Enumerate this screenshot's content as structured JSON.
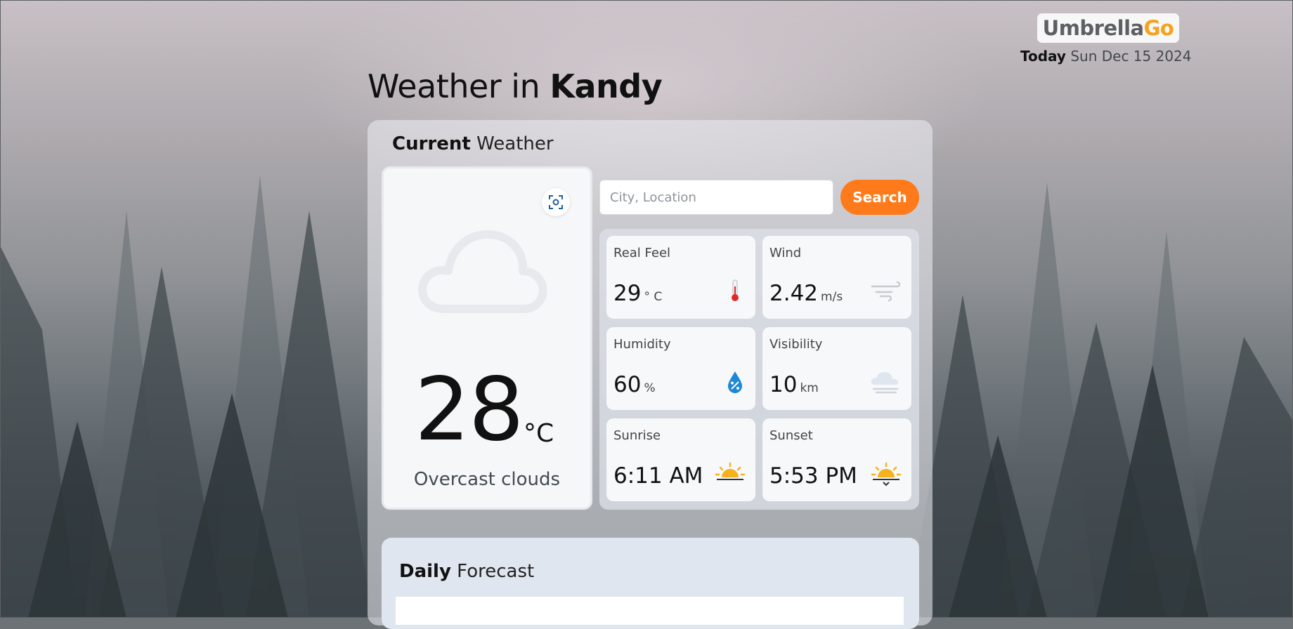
{
  "brand": {
    "part1": "Umbrella",
    "part2": "Go"
  },
  "today": {
    "label": "Today",
    "date": "Sun Dec 15 2024"
  },
  "title": {
    "prefix": "Weather in ",
    "city": "Kandy"
  },
  "current_heading": {
    "bold": "Current",
    "rest": " Weather"
  },
  "current": {
    "temperature": "28",
    "unit": "°C",
    "description": "Overcast clouds",
    "icon": "cloud-icon"
  },
  "search": {
    "placeholder": "City, Location",
    "button": "Search"
  },
  "stats": [
    {
      "label": "Real Feel",
      "value": "29",
      "unit": "° C",
      "icon": "thermometer-icon"
    },
    {
      "label": "Wind",
      "value": "2.42",
      "unit": "m/s",
      "icon": "wind-icon"
    },
    {
      "label": "Humidity",
      "value": "60",
      "unit": "%",
      "icon": "humidity-drop-icon"
    },
    {
      "label": "Visibility",
      "value": "10",
      "unit": "km",
      "icon": "fog-cloud-icon"
    },
    {
      "label": "Sunrise",
      "value": "6:11 AM",
      "unit": "",
      "icon": "sunrise-icon"
    },
    {
      "label": "Sunset",
      "value": "5:53 PM",
      "unit": "",
      "icon": "sunset-icon"
    }
  ],
  "daily_heading": {
    "bold": "Daily",
    "rest": " Forecast"
  },
  "colors": {
    "accent": "#ff7a1a",
    "brand_go": "#f6a21a"
  }
}
